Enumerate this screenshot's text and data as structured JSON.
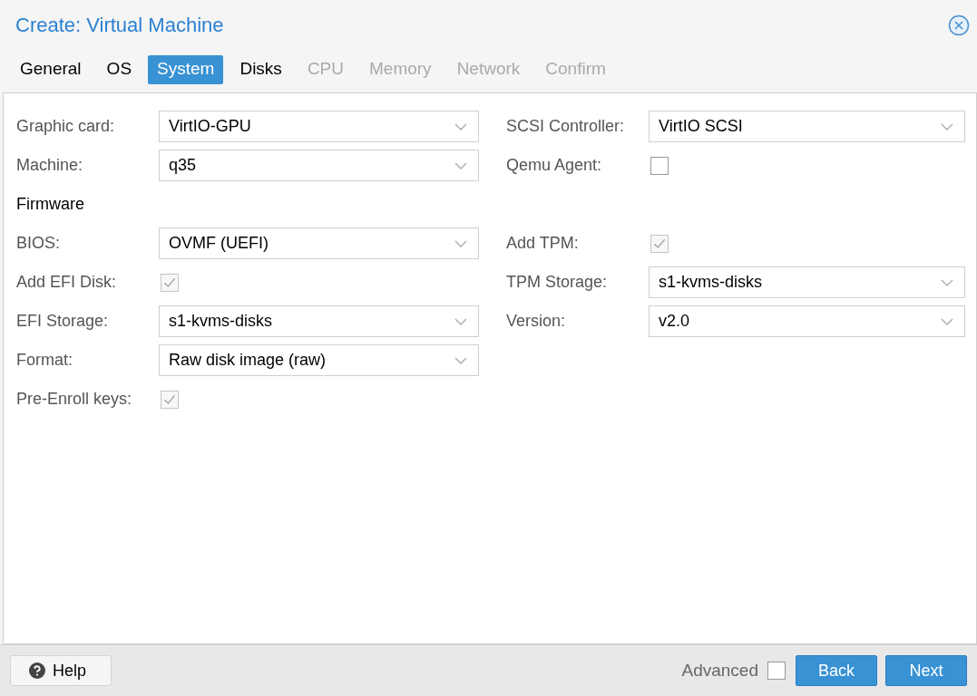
{
  "window": {
    "title": "Create: Virtual Machine"
  },
  "tabs": [
    {
      "label": "General",
      "selected": false,
      "disabled": false
    },
    {
      "label": "OS",
      "selected": false,
      "disabled": false
    },
    {
      "label": "System",
      "selected": true,
      "disabled": false
    },
    {
      "label": "Disks",
      "selected": false,
      "disabled": false
    },
    {
      "label": "CPU",
      "selected": false,
      "disabled": true
    },
    {
      "label": "Memory",
      "selected": false,
      "disabled": true
    },
    {
      "label": "Network",
      "selected": false,
      "disabled": true
    },
    {
      "label": "Confirm",
      "selected": false,
      "disabled": true
    }
  ],
  "rows": [
    {
      "left": {
        "kind": "combo",
        "label": "Graphic card:",
        "value": "VirtIO-GPU"
      },
      "right": {
        "kind": "combo",
        "label": "SCSI Controller:",
        "value": "VirtIO SCSI"
      }
    },
    {
      "left": {
        "kind": "combo",
        "label": "Machine:",
        "value": "q35"
      },
      "right": {
        "kind": "checkbox",
        "label": "Qemu Agent:",
        "checked": false,
        "disabled": false
      }
    },
    {
      "left": {
        "kind": "heading",
        "label": "Firmware"
      }
    },
    {
      "left": {
        "kind": "combo",
        "label": "BIOS:",
        "value": "OVMF (UEFI)"
      },
      "right": {
        "kind": "checkbox",
        "label": "Add TPM:",
        "checked": true,
        "disabled": true
      }
    },
    {
      "left": {
        "kind": "checkbox",
        "label": "Add EFI Disk:",
        "checked": true,
        "disabled": true
      },
      "right": {
        "kind": "combo",
        "label": "TPM Storage:",
        "value": "s1-kvms-disks"
      }
    },
    {
      "left": {
        "kind": "combo",
        "label": "EFI Storage:",
        "value": "s1-kvms-disks"
      },
      "right": {
        "kind": "combo",
        "label": "Version:",
        "value": "v2.0"
      }
    },
    {
      "left": {
        "kind": "combo",
        "label": "Format:",
        "value": "Raw disk image (raw)"
      }
    },
    {
      "left": {
        "kind": "checkbox",
        "label": "Pre-Enroll keys:",
        "checked": true,
        "disabled": true
      }
    }
  ],
  "footer": {
    "help": "Help",
    "advanced": {
      "label": "Advanced",
      "checked": false
    },
    "buttons": [
      "Back",
      "Next"
    ]
  }
}
